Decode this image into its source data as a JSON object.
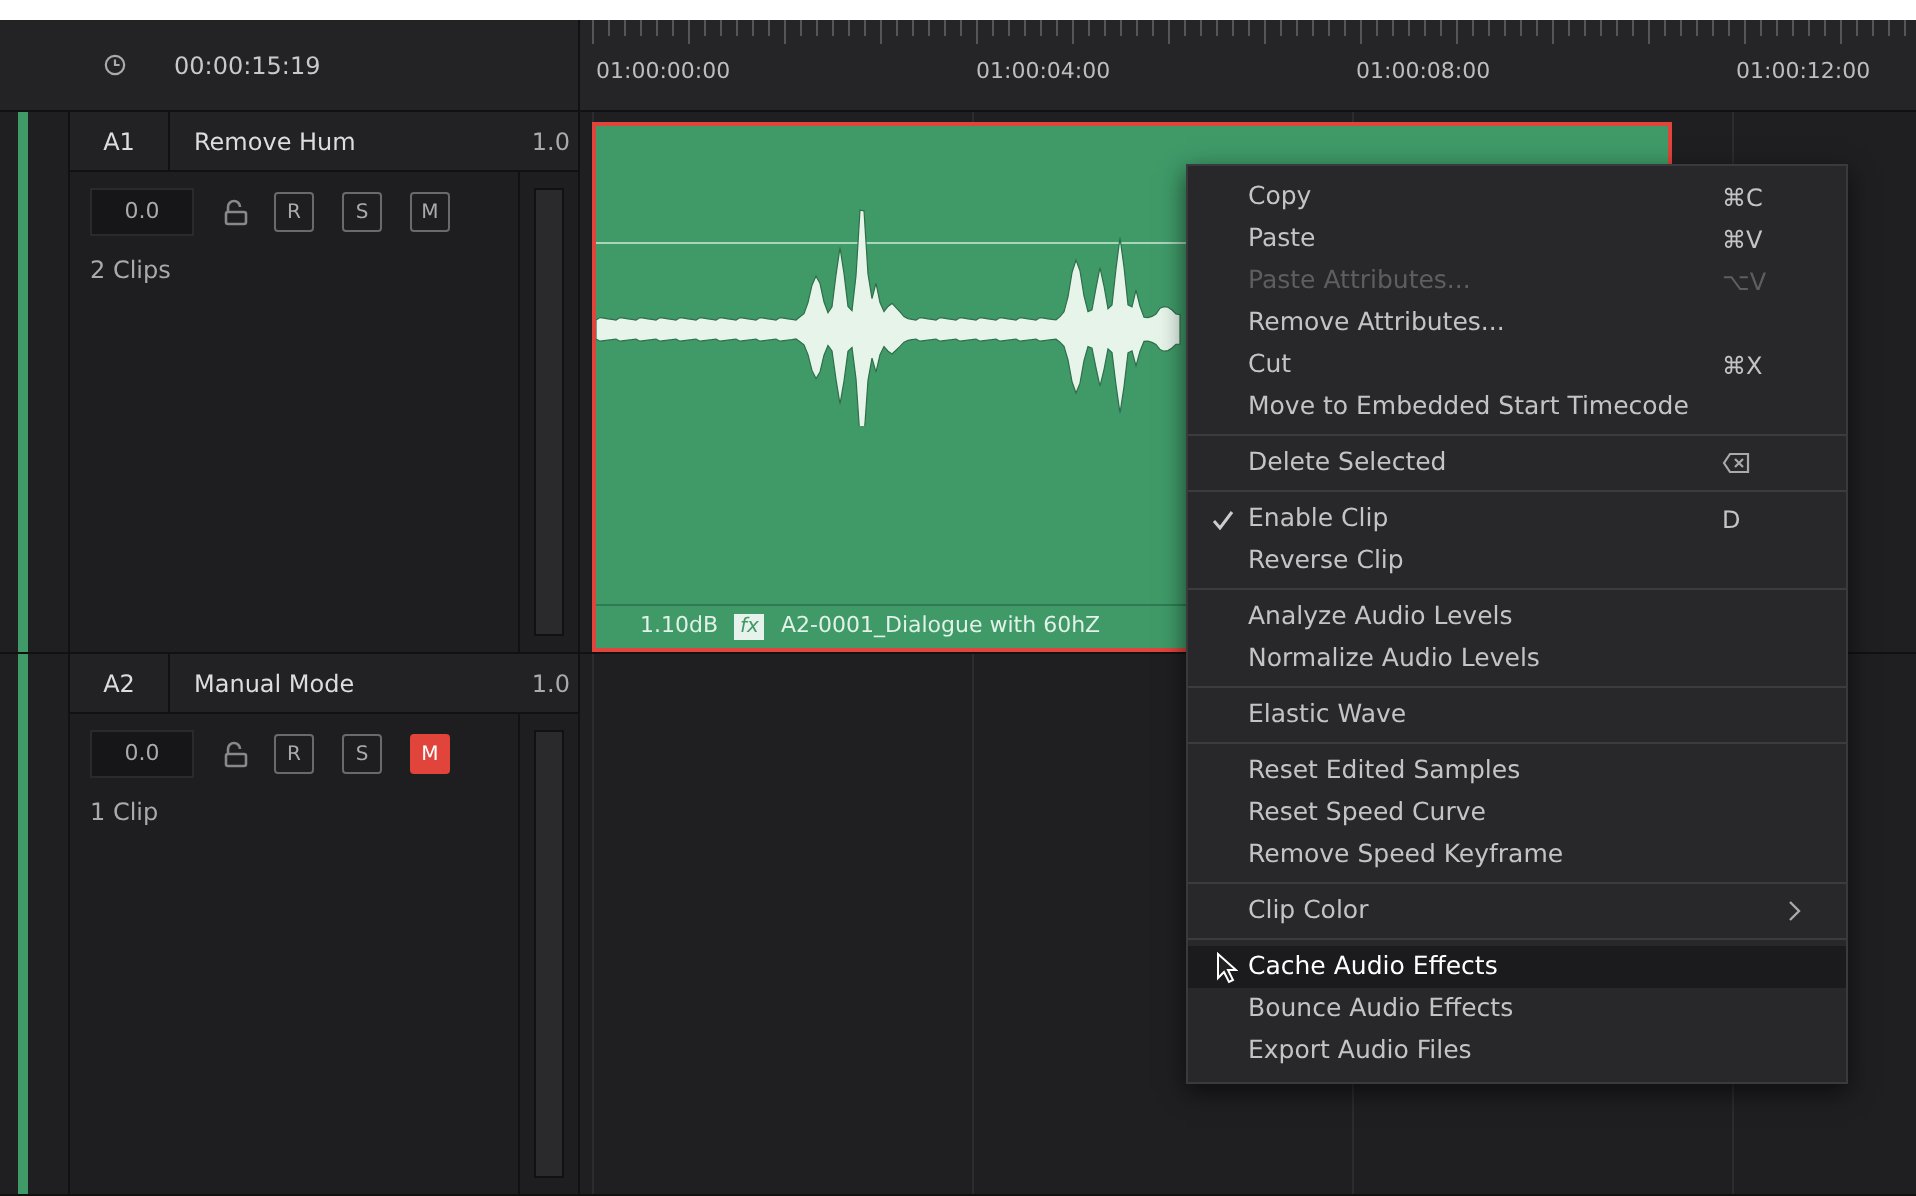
{
  "header": {
    "timecode": "00:00:15:19"
  },
  "ruler": {
    "labels": [
      "01:00:00:00",
      "01:00:04:00",
      "01:00:08:00",
      "01:00:12:00"
    ]
  },
  "tracks": [
    {
      "id": "A1",
      "name": "Remove Hum",
      "level": "1.0",
      "volume": "0.0",
      "clip_count": "2 Clips",
      "color": "#3f9a68",
      "buttons": [
        {
          "label": "R",
          "on": false
        },
        {
          "label": "S",
          "on": false
        },
        {
          "label": "M",
          "on": false
        }
      ],
      "clip": {
        "selected": true,
        "gain": "1.10dB",
        "fx": "fx",
        "name": "A2-0001_Dialogue with 60hZ"
      }
    },
    {
      "id": "A2",
      "name": "Manual Mode",
      "level": "1.0",
      "volume": "0.0",
      "clip_count": "1 Clip",
      "color": "#3f9a68",
      "buttons": [
        {
          "label": "R",
          "on": false
        },
        {
          "label": "S",
          "on": false
        },
        {
          "label": "M",
          "on": true
        }
      ]
    }
  ],
  "menu": {
    "items": [
      {
        "kind": "item",
        "label": "Copy",
        "shortcut": "⌘C",
        "disabled": false,
        "checked": false,
        "selected": false
      },
      {
        "kind": "item",
        "label": "Paste",
        "shortcut": "⌘V",
        "disabled": false,
        "checked": false,
        "selected": false
      },
      {
        "kind": "item",
        "label": "Paste Attributes...",
        "shortcut": "⌥V",
        "disabled": true,
        "checked": false,
        "selected": false
      },
      {
        "kind": "item",
        "label": "Remove Attributes...",
        "disabled": false,
        "checked": false,
        "selected": false
      },
      {
        "kind": "item",
        "label": "Cut",
        "shortcut": "⌘X",
        "disabled": false,
        "checked": false,
        "selected": false
      },
      {
        "kind": "item",
        "label": "Move to Embedded Start Timecode",
        "disabled": false,
        "checked": false,
        "selected": false
      },
      {
        "kind": "separator"
      },
      {
        "kind": "item",
        "label": "Delete Selected",
        "shortcut_icon": true,
        "disabled": false,
        "checked": false,
        "selected": false
      },
      {
        "kind": "separator"
      },
      {
        "kind": "item",
        "label": "Enable Clip",
        "shortcut": "D",
        "disabled": false,
        "checked": true,
        "selected": false
      },
      {
        "kind": "item",
        "label": "Reverse Clip",
        "disabled": false,
        "checked": false,
        "selected": false
      },
      {
        "kind": "separator"
      },
      {
        "kind": "item",
        "label": "Analyze Audio Levels",
        "disabled": false,
        "checked": false,
        "selected": false
      },
      {
        "kind": "item",
        "label": "Normalize Audio Levels",
        "disabled": false,
        "checked": false,
        "selected": false
      },
      {
        "kind": "separator"
      },
      {
        "kind": "item",
        "label": "Elastic Wave",
        "disabled": false,
        "checked": false,
        "selected": false
      },
      {
        "kind": "separator"
      },
      {
        "kind": "item",
        "label": "Reset Edited Samples",
        "disabled": false,
        "checked": false,
        "selected": false
      },
      {
        "kind": "item",
        "label": "Reset Speed Curve",
        "disabled": false,
        "checked": false,
        "selected": false
      },
      {
        "kind": "item",
        "label": "Remove Speed Keyframe",
        "disabled": false,
        "checked": false,
        "selected": false
      },
      {
        "kind": "separator"
      },
      {
        "kind": "item",
        "label": "Clip Color",
        "submenu": true,
        "disabled": false,
        "checked": false,
        "selected": false
      },
      {
        "kind": "separator"
      },
      {
        "kind": "item",
        "label": "Cache Audio Effects",
        "disabled": false,
        "checked": false,
        "selected": true
      },
      {
        "kind": "item",
        "label": "Bounce Audio Effects",
        "disabled": false,
        "checked": false,
        "selected": false
      },
      {
        "kind": "item",
        "label": "Export Audio Files",
        "disabled": false,
        "checked": false,
        "selected": false
      }
    ]
  }
}
